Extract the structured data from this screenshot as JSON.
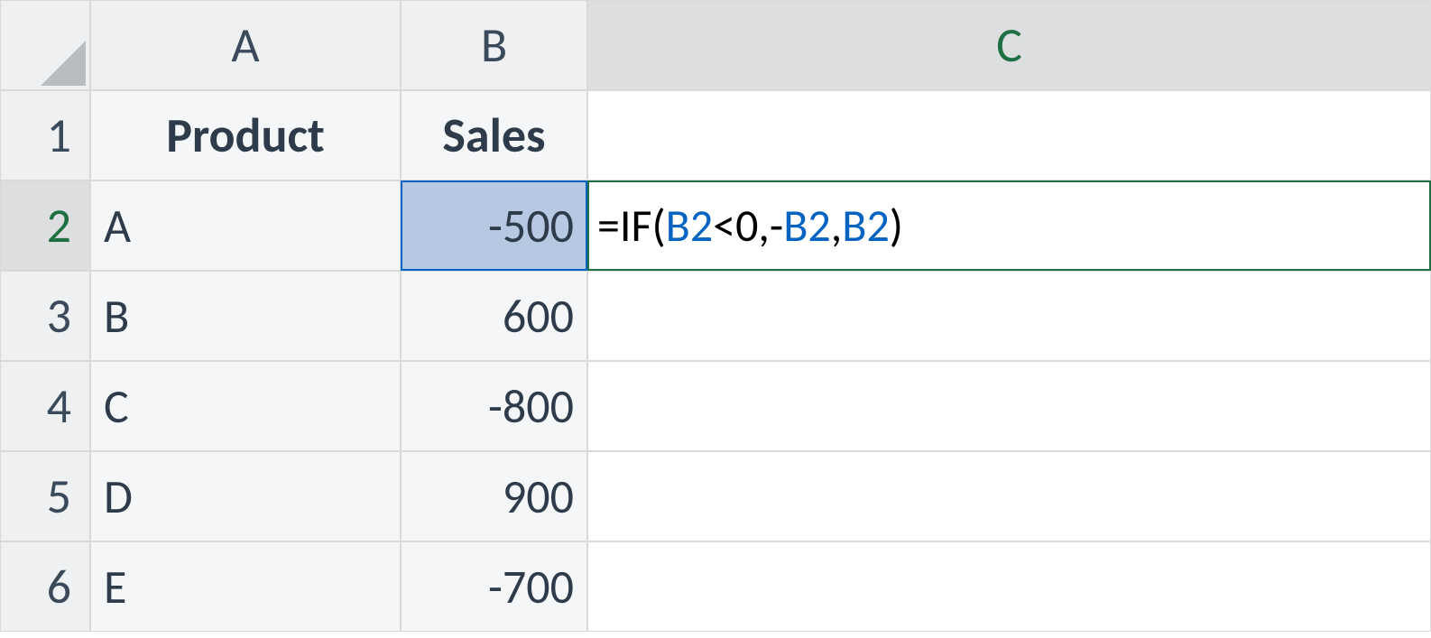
{
  "columns": {
    "A": "A",
    "B": "B",
    "C": "C"
  },
  "row_headers": [
    "1",
    "2",
    "3",
    "4",
    "5",
    "6"
  ],
  "headers": {
    "A": "Product",
    "B": "Sales"
  },
  "rows": [
    {
      "product": "A",
      "sales": "-500"
    },
    {
      "product": "B",
      "sales": "600"
    },
    {
      "product": "C",
      "sales": "-800"
    },
    {
      "product": "D",
      "sales": "900"
    },
    {
      "product": "E",
      "sales": "-700"
    }
  ],
  "formula": {
    "prefix": "=IF(",
    "ref1": "B2",
    "mid1": "<0,-",
    "ref2": "B2",
    "mid2": ",",
    "ref3": "B2",
    "suffix": ")"
  },
  "active_cell": "C2",
  "highlighted_ref_cell": "B2"
}
